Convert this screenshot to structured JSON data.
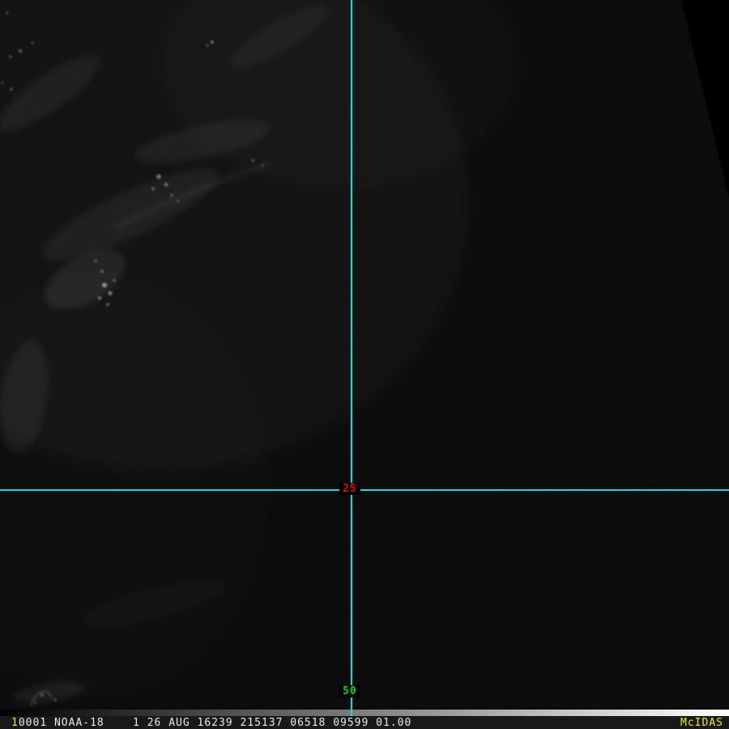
{
  "colors": {
    "crosshair": "#0fdede",
    "label-red": "#f20000",
    "label-green": "#00e000",
    "yellow": "#f0ee18",
    "statusbar-bg": "#191919",
    "statusbar-text": "#ebebeb",
    "gradient-start": "#000000",
    "gradient-end": "#ffffff"
  },
  "crosshair": {
    "intersection_label": "25",
    "bottom_label": "50"
  },
  "status_bar": {
    "frame_number": "1",
    "info": "0001 NOAA-18    1 26 AUG 16239 215137 06518 09599 01.00",
    "brand": "McIDAS"
  }
}
